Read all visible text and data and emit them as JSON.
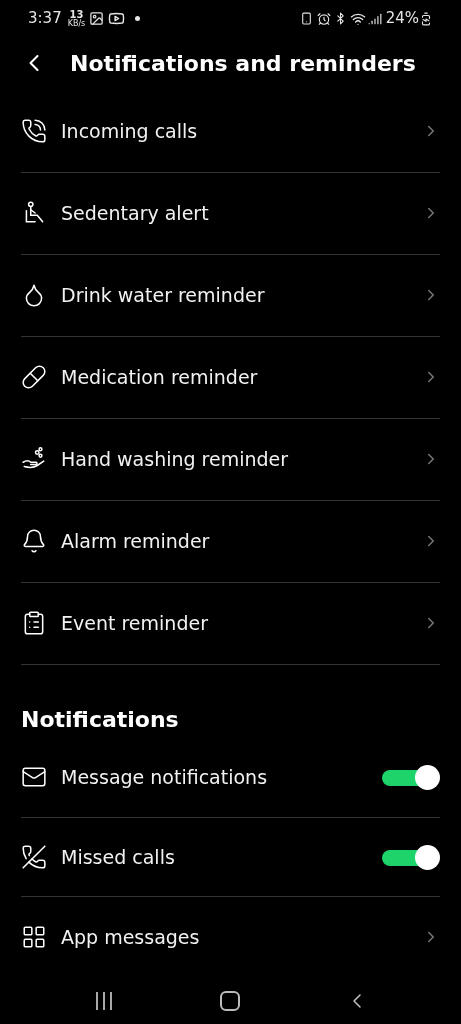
{
  "status_bar": {
    "time": "3:37",
    "speed_value": "13",
    "speed_unit": "KB/s",
    "battery": "24%"
  },
  "header": {
    "title": "Notifications and reminders"
  },
  "reminders": [
    {
      "label": "Incoming calls"
    },
    {
      "label": "Sedentary alert"
    },
    {
      "label": "Drink water reminder"
    },
    {
      "label": "Medication reminder"
    },
    {
      "label": "Hand washing reminder"
    },
    {
      "label": "Alarm reminder"
    },
    {
      "label": "Event reminder"
    }
  ],
  "notifications": {
    "title": "Notifications",
    "items": [
      {
        "label": "Message notifications",
        "kind": "toggle",
        "on": true
      },
      {
        "label": "Missed calls",
        "kind": "toggle",
        "on": true
      },
      {
        "label": "App messages",
        "kind": "link"
      }
    ]
  }
}
